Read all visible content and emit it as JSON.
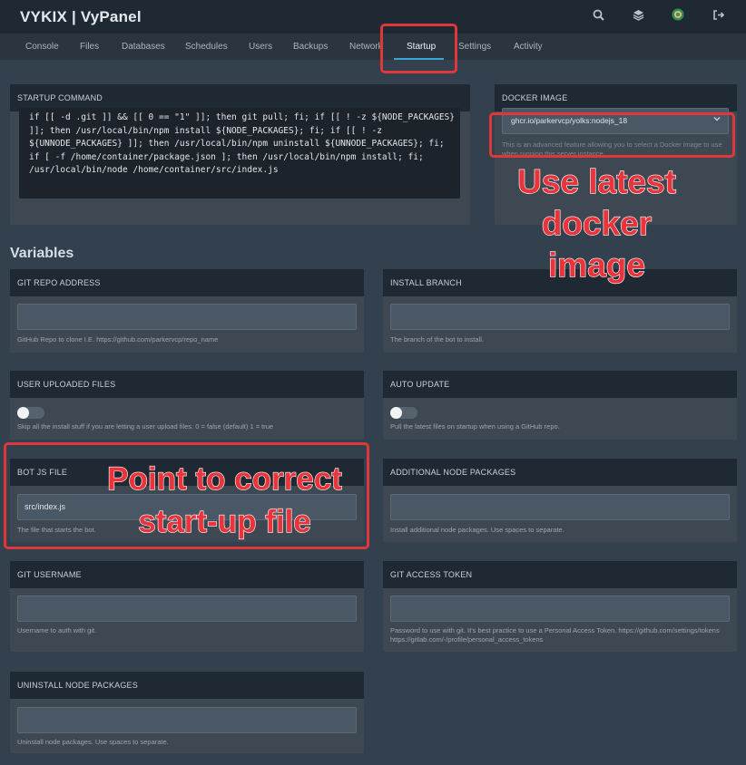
{
  "header": {
    "brand": "VYKIX | VyPanel"
  },
  "icons": {
    "search": "search-icon",
    "layers": "layers-icon",
    "avatar": "user-avatar-icon",
    "logout": "logout-icon"
  },
  "nav": {
    "tabs": [
      {
        "label": "Console"
      },
      {
        "label": "Files"
      },
      {
        "label": "Databases"
      },
      {
        "label": "Schedules"
      },
      {
        "label": "Users"
      },
      {
        "label": "Backups"
      },
      {
        "label": "Network"
      },
      {
        "label": "Startup",
        "active": true
      },
      {
        "label": "Settings"
      },
      {
        "label": "Activity"
      }
    ]
  },
  "startup": {
    "title": "STARTUP COMMAND",
    "command": "if [[ -d .git ]] && [[ 0 == \"1\" ]]; then git pull; fi; if [[ ! -z ${NODE_PACKAGES} ]]; then /usr/local/bin/npm install ${NODE_PACKAGES}; fi; if [[ ! -z ${UNNODE_PACKAGES} ]]; then /usr/local/bin/npm uninstall ${UNNODE_PACKAGES}; fi; if [ -f /home/container/package.json ]; then /usr/local/bin/npm install; fi; /usr/local/bin/node /home/container/src/index.js"
  },
  "docker": {
    "title": "DOCKER IMAGE",
    "selected": "ghcr.io/parkervcp/yolks:nodejs_18",
    "help": "This is an advanced feature allowing you to select a Docker image to use when running this server instance."
  },
  "variables": {
    "title": "Variables",
    "git_repo": {
      "label": "GIT REPO ADDRESS",
      "value": "",
      "help": "GitHub Repo to clone I.E. https://github.com/parkervcp/repo_name"
    },
    "install_branch": {
      "label": "INSTALL BRANCH",
      "value": "",
      "help": "The branch of the bot to install."
    },
    "user_uploaded": {
      "label": "USER UPLOADED FILES",
      "enabled": false,
      "help": "Skip all the install stuff if you are letting a user upload files. 0 = false (default) 1 = true"
    },
    "auto_update": {
      "label": "AUTO UPDATE",
      "enabled": false,
      "help": "Pull the latest files on startup when using a GitHub repo."
    },
    "bot_js": {
      "label": "BOT JS FILE",
      "value": "src/index.js",
      "help": "The file that starts the bot."
    },
    "node_packages": {
      "label": "ADDITIONAL NODE PACKAGES",
      "value": "",
      "help": "Install additional node packages. Use spaces to separate."
    },
    "git_username": {
      "label": "GIT USERNAME",
      "value": "",
      "help": "Username to auth with git."
    },
    "git_token": {
      "label": "GIT ACCESS TOKEN",
      "value": "",
      "help": "Password to use with git. It's best practice to use a Personal Access Token. https://github.com/settings/tokens https://gitlab.com/-/profile/personal_access_tokens"
    },
    "uninstall_packages": {
      "label": "UNINSTALL NODE PACKAGES",
      "value": "",
      "help": "Uninstall node packages. Use spaces to separate."
    }
  },
  "annotations": {
    "docker": "Use latest docker image",
    "botfile": "Point to correct start-up file"
  },
  "colors": {
    "annotation": "#e0373a",
    "tab_underline": "#3ba5d6",
    "panel_header": "#1f2933"
  }
}
